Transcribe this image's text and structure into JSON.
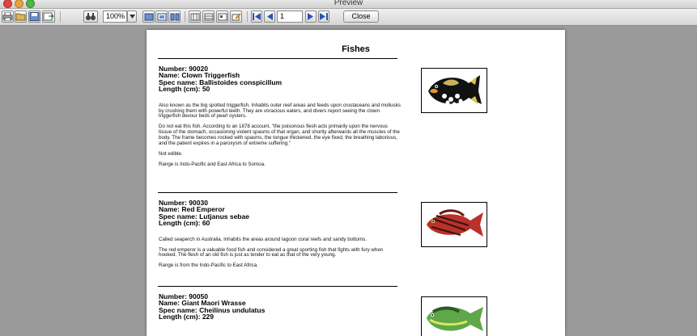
{
  "window": {
    "title": "Preview"
  },
  "toolbar": {
    "zoom_value": "100%",
    "page_value": "1",
    "close_label": "Close"
  },
  "report": {
    "title": "Fishes",
    "records": [
      {
        "number": "Number: 90020",
        "name": "Name: Clown Triggerfish",
        "spec": "Spec name: Ballistoides conspicillum",
        "length": "Length (cm): 50",
        "paragraphs": [
          "Also known as the big spotted triggerfish.  Inhabits outer reef areas and feeds upon crustaceans and mollusks by crushing them with powerful teeth.  They are voracious eaters, and divers report seeing the clown triggerfish devour beds of pearl oysters.",
          "Do not eat this fish.  According to an 1878 account, \"the poisonous flesh acts primarily upon the nervous tissue of the stomach, occasioning violent spasms of that organ, and shortly afterwards all the muscles of the body.  The frame becomes rocked with spasms, the tongue thickened, the eye fixed, the breathing laborious, and the patient expires in a paroxysm of extreme suffering.\"",
          "Not edible.",
          "Range is Indo-Pacific and East Africa to Somoa."
        ]
      },
      {
        "number": "Number: 90030",
        "name": "Name: Red Emperor",
        "spec": "Spec name: Lutjanus sebae",
        "length": "Length (cm): 60",
        "paragraphs": [
          "Called seaperch in Australia.  Inhabits the areas around lagoon coral reefs and sandy bottoms.",
          "The red emperor is a valuable food fish and considered a great sporting fish that fights with fury when hooked.  The flesh of an old fish is just as tender to eat as that of the very young.",
          "Range is from the Indo-Pacific to East Africa."
        ]
      },
      {
        "number": "Number: 90050",
        "name": "Name: Giant Maori Wrasse",
        "spec": "Spec name: Cheilinus undulatus",
        "length": "Length (cm): 229"
      }
    ]
  }
}
